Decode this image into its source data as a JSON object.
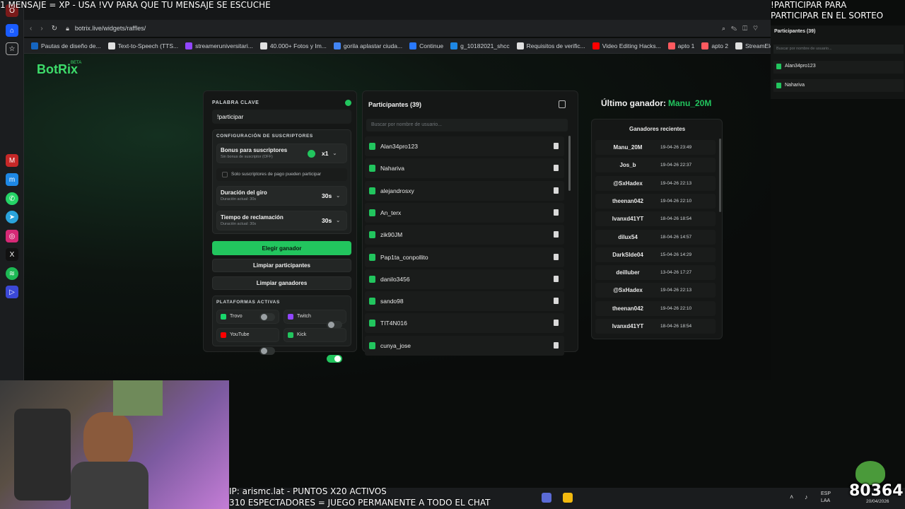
{
  "overlay": {
    "top_left": "1 MENSAJE = XP - USA !VV PARA QUE TU MENSAJE SE ESCUCHE",
    "top_right_line1": "!PARTICIPAR PARA",
    "top_right_line2": "PARTICIPAR EN EL SORTEO",
    "bottom_line1": "IP: arismc.lat - PUNTOS X20 ACTIVOS",
    "bottom_line2": "310 ESPECTADORES = JUEGO PERMANENTE A TODO EL CHAT",
    "counter": "80364"
  },
  "browser": {
    "url": "botrix.live/widgets/raffles/",
    "bookmarks": [
      {
        "label": "Pautas de diseño de...",
        "color": "#1565c0"
      },
      {
        "label": "Text-to-Speech (TTS...",
        "color": "#e0e0e0"
      },
      {
        "label": "streameruniversitari...",
        "color": "#9146ff"
      },
      {
        "label": "40.000+ Fotos y Im...",
        "color": "#e0e0e0"
      },
      {
        "label": "gorila aplastar ciuda...",
        "color": "#4285f4"
      },
      {
        "label": "Continue",
        "color": "#2979ff"
      },
      {
        "label": "g_10182021_shcc",
        "color": "#1e88e5"
      },
      {
        "label": "Requisitos de verific...",
        "color": "#e0e0e0"
      },
      {
        "label": "Video Editing Hacks...",
        "color": "#ff0000"
      },
      {
        "label": "apto 1",
        "color": "#ff5a5f"
      },
      {
        "label": "apto 2",
        "color": "#ff5a5f"
      },
      {
        "label": "StreamElements - st...",
        "color": "#e0e0e0"
      }
    ]
  },
  "app": {
    "logo": "BotRix",
    "logo_badge": "BETA"
  },
  "config": {
    "keyword_label": "PALABRA CLAVE",
    "keyword_value": "!participar",
    "subs_section_label": "CONFIGURACIÓN DE SUSCRIPTORES",
    "bonus_title": "Bonus para suscriptores",
    "bonus_sub": "Sin bonus de suscriptor (OFF)",
    "bonus_value": "x1",
    "paid_only_label": "Solo suscriptores de pago pueden participar",
    "spin_title": "Duración del giro",
    "spin_sub": "Duración actual: 30s",
    "spin_value": "30s",
    "claim_title": "Tiempo de reclamación",
    "claim_sub": "Duración actual: 30s",
    "claim_value": "30s",
    "pick_winner": "Elegir ganador",
    "clear_participants": "Limpiar participantes",
    "clear_winners": "Limpiar ganadores",
    "platforms_label": "PLATAFORMAS ACTIVAS",
    "platforms": [
      {
        "name": "Trovo",
        "on": false
      },
      {
        "name": "Twitch",
        "on": false
      },
      {
        "name": "YouTube",
        "on": false
      },
      {
        "name": "Kick",
        "on": true
      }
    ]
  },
  "participants": {
    "title": "Participantes (39)",
    "search_placeholder": "Buscar por nombre de usuario...",
    "items": [
      "Alan34pro123",
      "Nahariva",
      "alejandrosxy",
      "An_terx",
      "zik90JM",
      "Pap1ta_conpollito",
      "danilo3456",
      "sando98",
      "TIT4N016",
      "cunya_jose"
    ]
  },
  "winner": {
    "label": "Último ganador:",
    "name": "Manu_20M",
    "recent_title": "Ganadores recientes",
    "items": [
      {
        "name": "Manu_20M",
        "date": "19-04-26 23:49"
      },
      {
        "name": "Jos_b",
        "date": "19-04-26 22:37"
      },
      {
        "name": "@SxHadex",
        "date": "19-04-26 22:13"
      },
      {
        "name": "theenan042",
        "date": "19-04-26 22:10"
      },
      {
        "name": "Ivanxd41YT",
        "date": "18-04-26 18:54"
      },
      {
        "name": "dilux54",
        "date": "18-04-26 14:57"
      },
      {
        "name": "DarkSlde04",
        "date": "15-04-26 14:29"
      },
      {
        "name": "deilluber",
        "date": "13-04-26 17:27"
      },
      {
        "name": "@SxHadex",
        "date": "19-04-26 22:13"
      },
      {
        "name": "theenan042",
        "date": "19-04-26 22:10"
      },
      {
        "name": "Ivanxd41YT",
        "date": "18-04-26 18:54"
      }
    ]
  },
  "side_list": {
    "title": "Participantes (39)",
    "search_placeholder": "Buscar por nombre de usuario...",
    "items": [
      "Alan34pro123",
      "Nahariva"
    ]
  },
  "taskbar": {
    "lang1": "ESP",
    "lang2": "LAA",
    "date": "20/04/2026"
  }
}
